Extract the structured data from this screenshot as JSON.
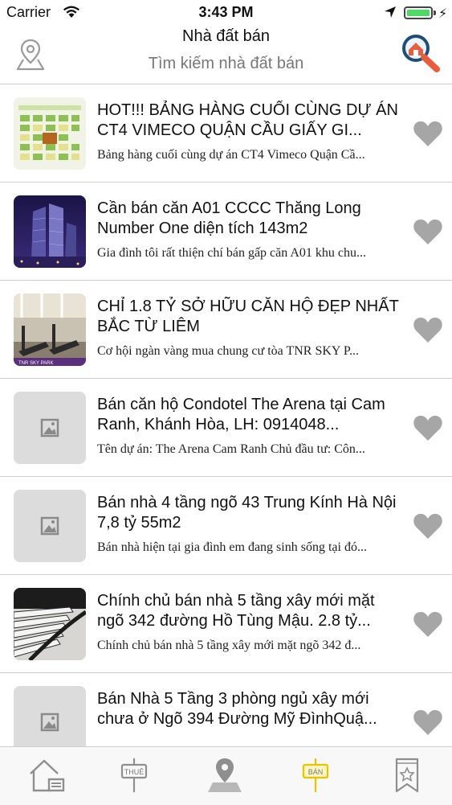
{
  "status_bar": {
    "carrier": "Carrier",
    "time": "3:43 PM",
    "battery_color": "#4cd964"
  },
  "header": {
    "title": "Nhà đất bán",
    "subtitle": "Tìm kiếm nhà đất bán",
    "left_icon": "map-pin-icon",
    "right_icon": "house-search-icon"
  },
  "listings": [
    {
      "title": "HOT!!! BẢNG HÀNG CUỐI CÙNG DỰ ÁN CT4 VIMECO QUẬN CẦU GIẤY GI...",
      "description": "Bảng hàng cuối cùng dự án CT4 Vimeco Quận Cầ...",
      "thumbnail": "floor-plan-image"
    },
    {
      "title": "Cần bán căn A01 CCCC Thăng Long Number One diện tích 143m2",
      "description": "Gia đình tôi rất thiện chí bán gấp căn A01 khu chu...",
      "thumbnail": "tower-night-image"
    },
    {
      "title": "CHỈ 1.8 TỶ SỞ HỮU CĂN HỘ ĐẸP NHẤT BẮC TỪ LIÊM",
      "description": "Cơ hội ngàn vàng mua chung cư tòa TNR SKY P...",
      "thumbnail": "gym-image"
    },
    {
      "title": "Bán căn hộ Condotel The Arena tại Cam Ranh, Khánh Hòa, LH: 0914048...",
      "description": "Tên dự án: The Arena Cam Ranh Chủ đầu tư: Côn...",
      "thumbnail": "placeholder-image"
    },
    {
      "title": "Bán nhà 4 tầng ngõ 43 Trung Kính Hà Nội 7,8 tỷ 55m2",
      "description": "Bán nhà hiện tại gia đình em đang sinh sống tại đó...",
      "thumbnail": "placeholder-image"
    },
    {
      "title": "Chính chủ bán nhà 5 tầng xây mới mặt ngõ 342 đường Hồ Tùng Mậu. 2.8 tỷ...",
      "description": "Chính chủ bán nhà 5 tầng xây mới mặt ngõ 342 đ...",
      "thumbnail": "staircase-image"
    },
    {
      "title": "Bán Nhà 5 Tầng 3 phòng ngủ xây mới chưa ở Ngõ 394 Đường Mỹ ĐìnhQuậ...",
      "description": "",
      "thumbnail": "placeholder-image"
    }
  ],
  "tabbar": {
    "tabs": [
      {
        "name": "home",
        "icon": "house-icon",
        "label": ""
      },
      {
        "name": "rent",
        "icon": "rent-sign-icon",
        "label": "THUÊ"
      },
      {
        "name": "map",
        "icon": "map-pin-icon",
        "label": ""
      },
      {
        "name": "sell",
        "icon": "sell-sign-icon",
        "label": "BÁN",
        "active": true
      },
      {
        "name": "saved",
        "icon": "bookmark-star-icon",
        "label": ""
      }
    ],
    "active_color": "#e8c400"
  }
}
